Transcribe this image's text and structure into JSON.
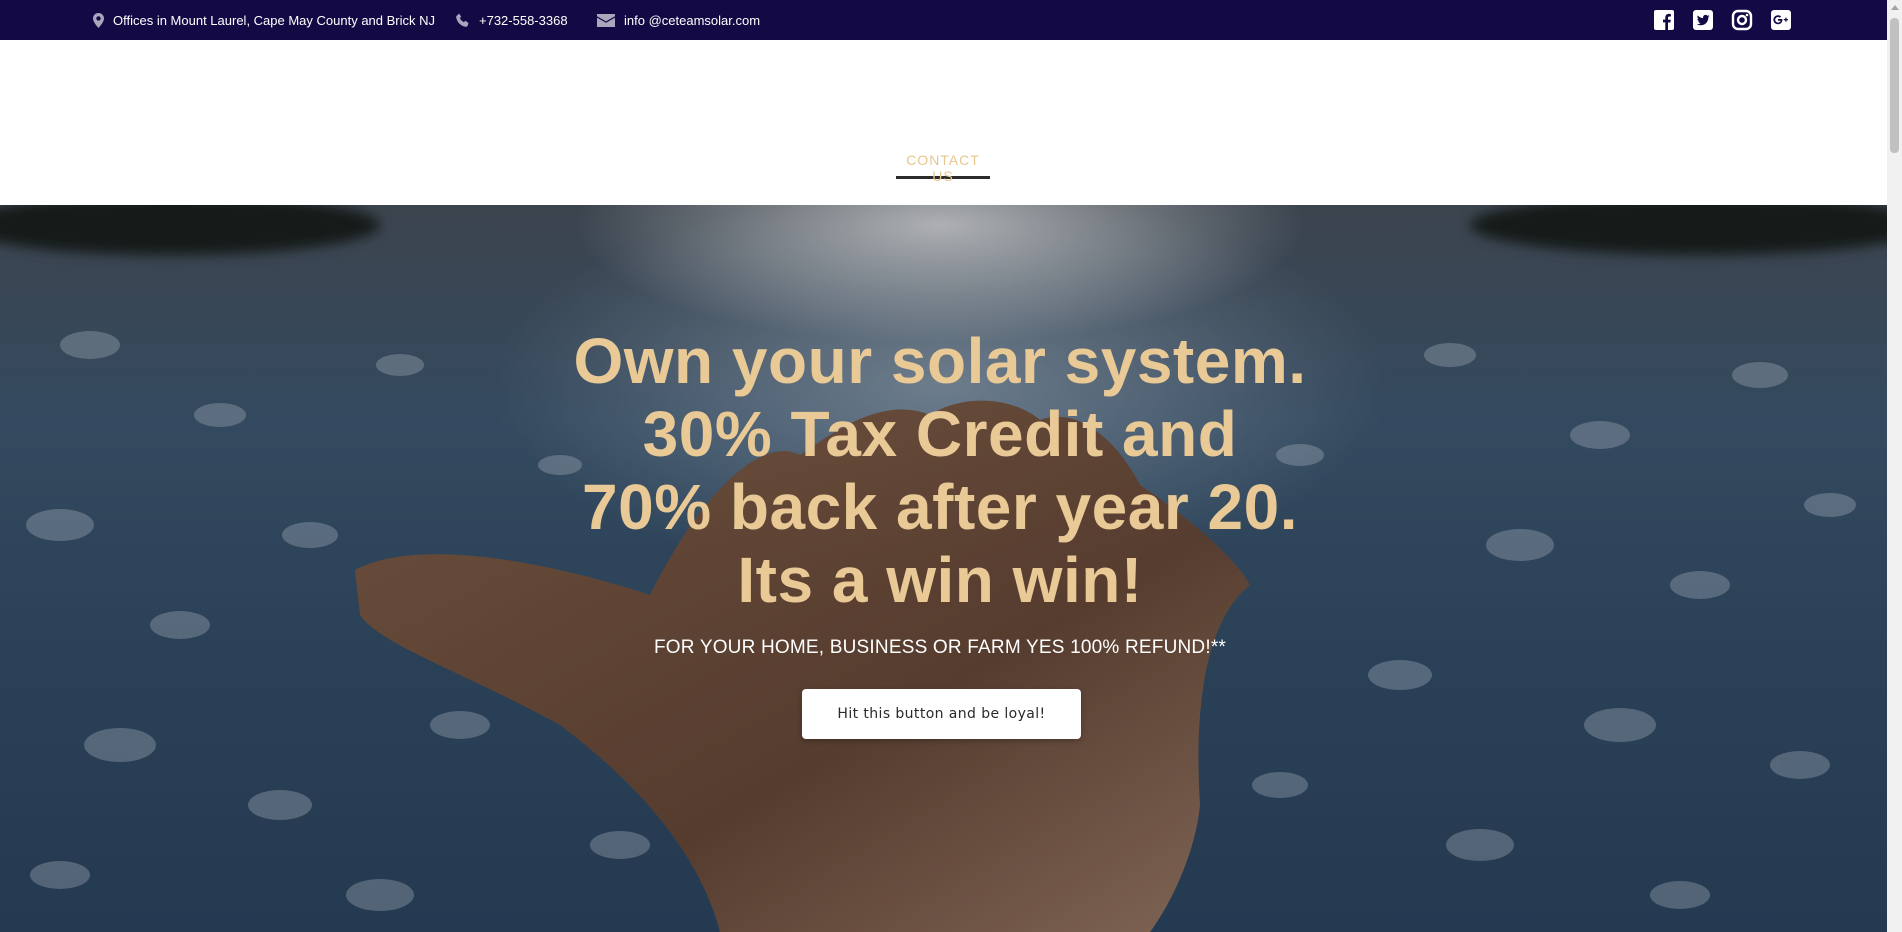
{
  "topbar": {
    "location": "Offices in Mount Laurel, Cape May County and Brick NJ",
    "phone": "+732-558-3368",
    "email": "info @ceteamsolar.com",
    "social": [
      "facebook-icon",
      "twitter-icon",
      "instagram-icon",
      "google-plus-icon"
    ]
  },
  "nav": {
    "contact": "CONTACT US"
  },
  "hero": {
    "line1": "Own your solar system.",
    "line2": "30% Tax Credit and",
    "line3": "70% back after year 20.",
    "line4": "Its a win win!",
    "subline": "FOR YOUR HOME, BUSINESS OR FARM YES 100% REFUND!**",
    "cta": "Hit this button and be loyal!"
  },
  "colors": {
    "topbar": "#130a45",
    "accent": "#e9c996",
    "nav_underline": "#2b2b2b"
  }
}
